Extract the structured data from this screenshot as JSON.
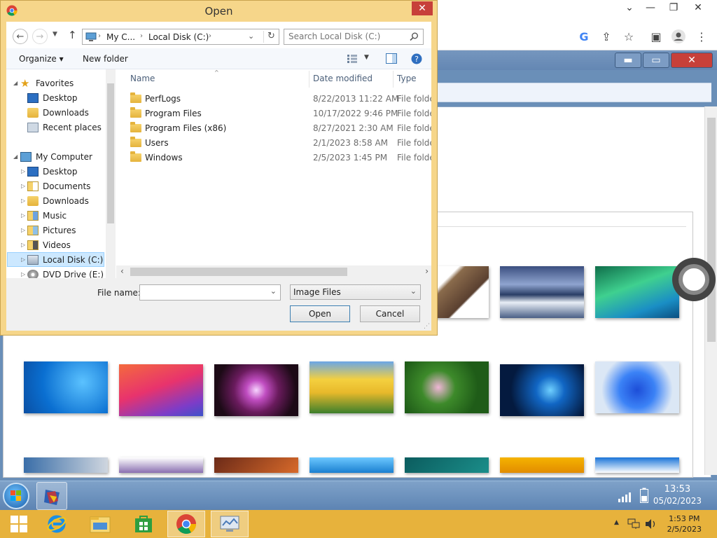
{
  "dialog": {
    "title": "Open",
    "close_glyph": "✕",
    "address": {
      "crumb1": "My C...",
      "crumb2": "Local Disk (C:)"
    },
    "search_placeholder": "Search Local Disk (C:)",
    "organize_label": "Organize ▾",
    "new_folder_label": "New folder",
    "nav_tree": [
      {
        "label": "Favorites",
        "icon": "star-icon"
      },
      {
        "label": "Desktop",
        "icon": "desktop-icon"
      },
      {
        "label": "Downloads",
        "icon": "downloads-icon"
      },
      {
        "label": "Recent places",
        "icon": "recent-places-icon"
      },
      {
        "label": "My Computer",
        "icon": "computer-icon"
      },
      {
        "label": "Desktop",
        "icon": "desktop-icon"
      },
      {
        "label": "Documents",
        "icon": "documents-icon"
      },
      {
        "label": "Downloads",
        "icon": "downloads-icon"
      },
      {
        "label": "Music",
        "icon": "music-icon"
      },
      {
        "label": "Pictures",
        "icon": "pictures-icon"
      },
      {
        "label": "Videos",
        "icon": "videos-icon"
      },
      {
        "label": "Local Disk (C:)",
        "icon": "drive-icon"
      },
      {
        "label": "DVD Drive (E:) CD",
        "icon": "dvd-icon"
      }
    ],
    "columns": {
      "name": "Name",
      "date": "Date modified",
      "type": "Type"
    },
    "files": [
      {
        "name": "PerfLogs",
        "date": "8/22/2013 11:22 AM",
        "type": "File folder"
      },
      {
        "name": "Program Files",
        "date": "10/17/2022 9:46 PM",
        "type": "File folder"
      },
      {
        "name": "Program Files (x86)",
        "date": "8/27/2021 2:30 AM",
        "type": "File folder"
      },
      {
        "name": "Users",
        "date": "2/1/2023 8:58 AM",
        "type": "File folder"
      },
      {
        "name": "Windows",
        "date": "2/5/2023 1:45 PM",
        "type": "File folder"
      }
    ],
    "file_name_label": "File name:",
    "file_name_value": "",
    "file_type_value": "Image Files",
    "open_label": "Open",
    "cancel_label": "Cancel"
  },
  "remote_taskbar": {
    "time": "13:53",
    "date": "05/02/2023"
  },
  "taskbar": {
    "time": "1:53 PM",
    "date": "2/5/2023"
  }
}
